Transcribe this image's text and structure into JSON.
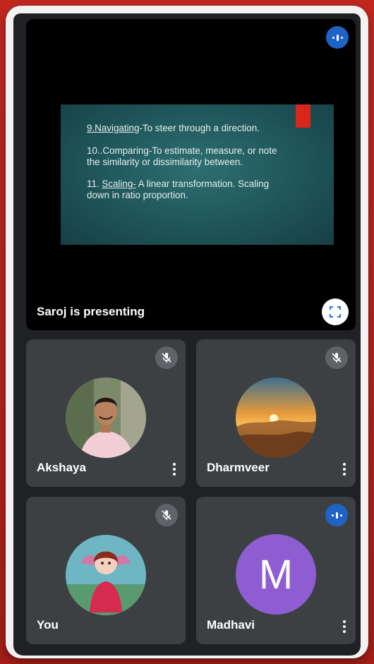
{
  "presentation": {
    "presenter_label": "Saroj is presenting",
    "slide": {
      "line1_term": "9.Navigating",
      "line1_rest": "-To steer through a direction.",
      "line2a": "10..Comparing-To estimate, measure, or note",
      "line2b": "the similarity or dissimilarity between.",
      "line3_prefix": "11. ",
      "line3_term": "Scaling-",
      "line3_rest": " A linear transformation. Scaling",
      "line3b": "down in ratio proportion."
    }
  },
  "participants": [
    {
      "name": "Akshaya",
      "status": "muted",
      "avatar": "photo-man-outdoors"
    },
    {
      "name": "Dharmveer",
      "status": "muted",
      "avatar": "photo-sunset-mountains"
    },
    {
      "name": "You",
      "status": "muted",
      "avatar": "photo-doll-figure"
    },
    {
      "name": "Madhavi",
      "status": "speaking",
      "avatar_letter": "M"
    }
  ],
  "icons": {
    "speaking": "audio-level-icon",
    "muted": "mic-off-icon",
    "fullscreen": "fullscreen-icon",
    "more": "more-vert-icon"
  },
  "colors": {
    "frame": "#b3231b",
    "background": "#202124",
    "tile": "#3c4043",
    "accent_blue": "#1f63c6",
    "avatar_purple": "#8e5dd1",
    "slide_teal": "#1f5558",
    "slide_red": "#d7261c"
  }
}
